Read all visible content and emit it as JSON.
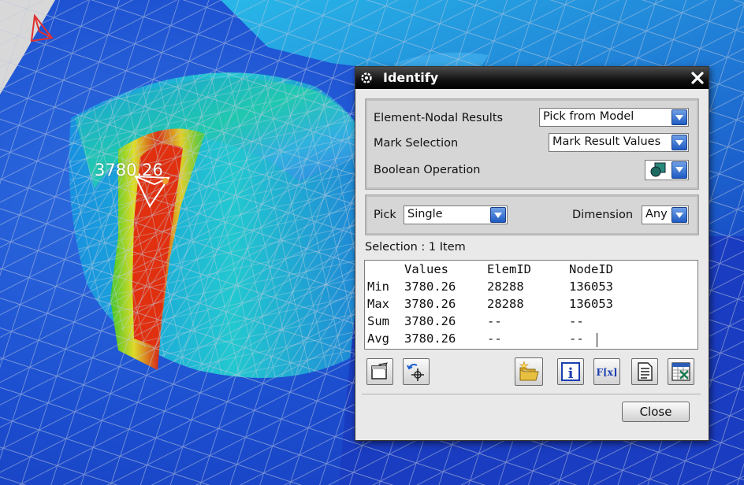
{
  "viewport": {
    "probe_value": "3780.26"
  },
  "dialog": {
    "title": "Identify",
    "element_nodal_results": {
      "label": "Element-Nodal Results",
      "value": "Pick from Model"
    },
    "mark_selection": {
      "label": "Mark Selection",
      "value": "Mark Result Values"
    },
    "boolean_operation": {
      "label": "Boolean Operation"
    },
    "pick": {
      "label": "Pick",
      "value": "Single"
    },
    "dimension": {
      "label": "Dimension",
      "value": "Any"
    },
    "selection_label": "Selection : 1 Item",
    "results": {
      "headers": [
        "Values",
        "ElemID",
        "NodeID"
      ],
      "rows": [
        {
          "name": "Min",
          "values": [
            "3780.26",
            "28288",
            "136053"
          ]
        },
        {
          "name": "Max",
          "values": [
            "3780.26",
            "28288",
            "136053"
          ]
        },
        {
          "name": "Sum",
          "values": [
            "3780.26",
            "--",
            "--"
          ]
        },
        {
          "name": "Avg",
          "values": [
            "3780.26",
            "--",
            "--"
          ]
        }
      ]
    },
    "close_label": "Close"
  },
  "colors": {
    "accent_arrow": "#1f5cc4",
    "titlebar": "#111111",
    "stress_high": "#e03010",
    "stress_low": "#1840c8"
  }
}
